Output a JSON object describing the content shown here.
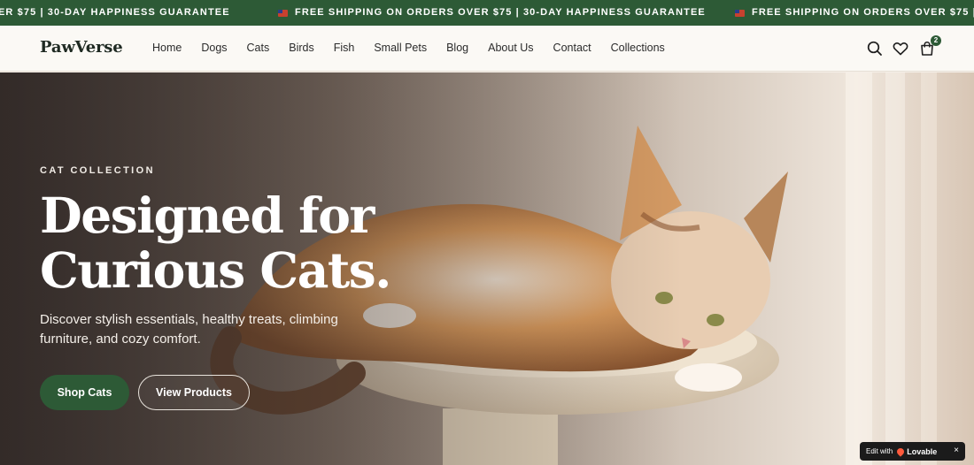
{
  "announcement": {
    "text_partial": "ER $75 | 30-DAY HAPPINESS GUARANTEE",
    "text": "FREE SHIPPING ON ORDERS OVER $75 | 30-DAY HAPPINESS GUARANTEE",
    "text_cut": "FREE SHIPPING ON ORDERS OVER $75 | 30-DAY HAPPINE",
    "flag_icon": "us-flag-icon"
  },
  "header": {
    "logo": "PawVerse",
    "nav": [
      "Home",
      "Dogs",
      "Cats",
      "Birds",
      "Fish",
      "Small Pets",
      "Blog",
      "About Us",
      "Contact",
      "Collections"
    ],
    "icons": {
      "search": "search-icon",
      "wishlist": "heart-icon",
      "cart": "shopping-bag-icon"
    },
    "cart_count": "2"
  },
  "hero": {
    "eyebrow": "CAT COLLECTION",
    "headline_line1": "Designed for",
    "headline_line2": "Curious Cats.",
    "subtext": "Discover stylish essentials, healthy treats, climbing furniture, and cozy comfort.",
    "primary_button": "Shop Cats",
    "secondary_button": "View Products",
    "image": "calico-cat-on-cat-tree-photo"
  },
  "lovable_badge": {
    "prefix": "Edit with",
    "brand": "Lovable",
    "close": "×"
  },
  "colors": {
    "brand_green": "#2d5a36",
    "header_bg": "#fbf9f5",
    "text_dark": "#1f2a23"
  }
}
